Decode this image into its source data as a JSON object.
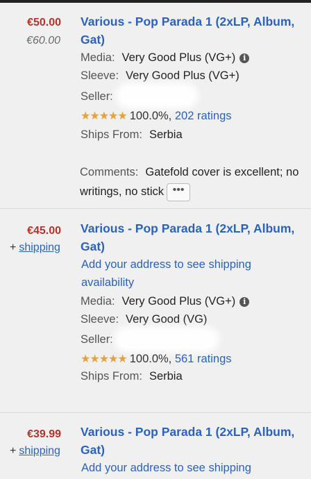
{
  "colors": {
    "price": "#b5322b",
    "link": "#2a62bd",
    "stars": "#e3a23a",
    "background": "#f0f0f0"
  },
  "listings": [
    {
      "price": "€50.00",
      "old_price": "€60.00",
      "title": "Various - Pop Parada 1 (2xLP, Album, Gat)",
      "media_label": "Media:",
      "media_value": "Very Good Plus (VG+)",
      "sleeve_label": "Sleeve:",
      "sleeve_value": "Very Good Plus (VG+)",
      "seller_label": "Seller:",
      "rating_stars": "★★★★★",
      "rating_pct": "100.0%,",
      "ratings_link": "202 ratings",
      "ships_label": "Ships From:",
      "ships_value": "Serbia",
      "comments_label": "Comments:",
      "comments_value": "Gatefold cover is excellent; no",
      "comments_cont": "writings, no stick",
      "more_label": "•••"
    },
    {
      "price": "€45.00",
      "ship_prefix": "+",
      "ship_link": "shipping",
      "title": "Various - Pop Parada 1 (2xLP, Album, Gat)",
      "address_link": "Add your address to see shipping availability",
      "media_label": "Media:",
      "media_value": "Very Good Plus (VG+)",
      "sleeve_label": "Sleeve:",
      "sleeve_value": "Very Good (VG)",
      "seller_label": "Seller:",
      "rating_stars": "★★★★★",
      "rating_pct": "100.0%,",
      "ratings_link": "561 ratings",
      "ships_label": "Ships From:",
      "ships_value": "Serbia"
    },
    {
      "price": "€39.99",
      "ship_prefix": "+",
      "ship_link": "shipping",
      "title": "Various - Pop Parada 1 (2xLP, Album, Gat)",
      "address_link": "Add your address to see shipping"
    }
  ]
}
